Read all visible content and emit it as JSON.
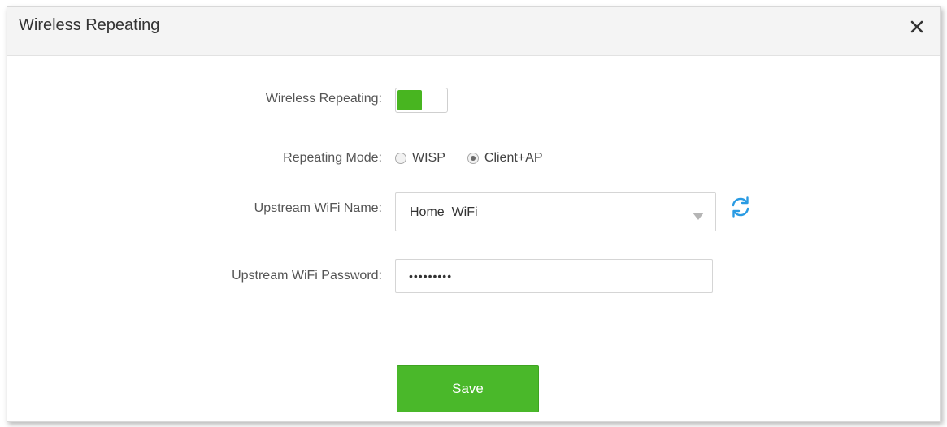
{
  "dialog": {
    "title": "Wireless Repeating",
    "close_icon": "close-icon"
  },
  "form": {
    "wireless_repeating": {
      "label": "Wireless Repeating:",
      "enabled": true
    },
    "repeating_mode": {
      "label": "Repeating Mode:",
      "options": [
        "WISP",
        "Client+AP"
      ],
      "selected": "Client+AP"
    },
    "upstream_wifi_name": {
      "label": "Upstream WiFi Name:",
      "value": "Home_WiFi",
      "refresh_icon": "refresh-icon"
    },
    "upstream_wifi_password": {
      "label": "Upstream WiFi Password:",
      "value": "•••••••••"
    }
  },
  "actions": {
    "save_label": "Save"
  },
  "colors": {
    "accent": "#4ab82a",
    "refresh_icon": "#2a9be3",
    "header_bg": "#f4f4f4"
  }
}
